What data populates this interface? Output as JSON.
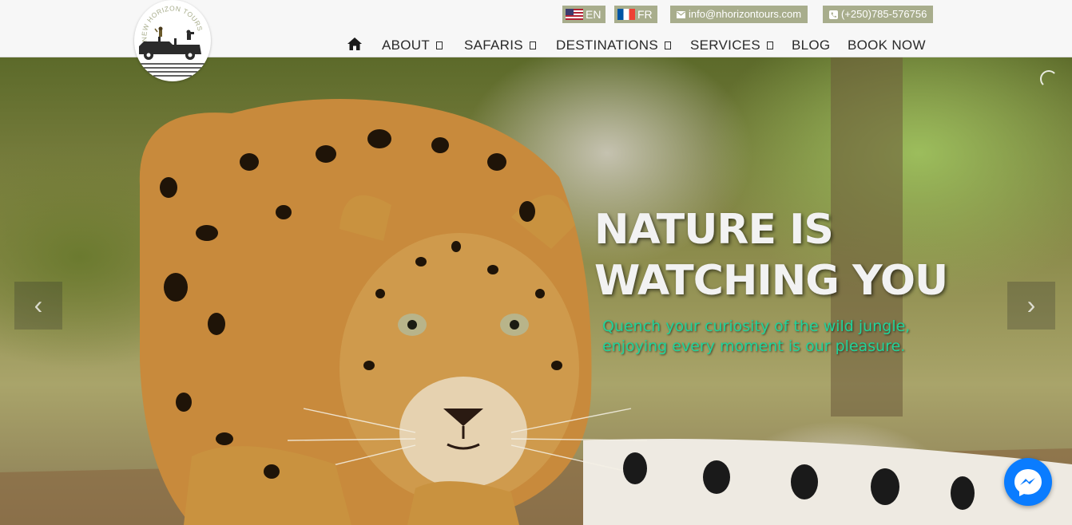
{
  "logo": {
    "ring_text": "NEW HORIZON TOURS"
  },
  "languages": [
    {
      "code_label": "EN",
      "flag": "us-flag-icon"
    },
    {
      "code_label": "FR",
      "flag": "fr-flag-icon"
    }
  ],
  "contact": {
    "email": "info@nhorizontours.com",
    "phone": "(+250)785-576756"
  },
  "nav": {
    "home_icon": "home-icon",
    "items": [
      {
        "label": "ABOUT",
        "dropdown": true
      },
      {
        "label": "SAFARIS",
        "dropdown": true
      },
      {
        "label": "DESTINATIONS",
        "dropdown": true
      },
      {
        "label": "SERVICES",
        "dropdown": true
      },
      {
        "label": "BLOG",
        "dropdown": false
      },
      {
        "label": "BOOK NOW",
        "dropdown": false
      }
    ]
  },
  "hero": {
    "headline_line1": "NATURE IS",
    "headline_line2": "WATCHING YOU",
    "subline_line1": "Quench your curiosity of the wild jungle,",
    "subline_line2": "enjoying every moment is our pleasure.",
    "prev_glyph": "‹",
    "next_glyph": "›"
  },
  "colors": {
    "topbar_bg": "#a8ad8c",
    "subline": "#22d39a",
    "messenger": "#0a7cff"
  }
}
